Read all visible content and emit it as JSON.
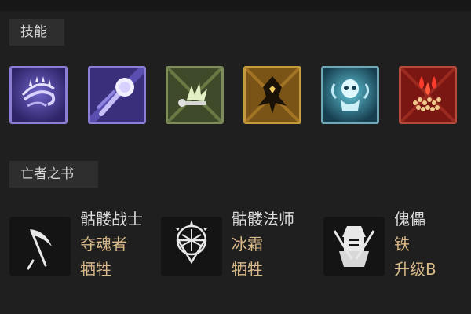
{
  "sections": {
    "skills_title": "技能",
    "book_title": "亡者之书"
  },
  "skills": [
    {
      "icon": "bone-spear-curve-icon",
      "border_color": "#8a7fd4",
      "bg_color": "#3a2f7a"
    },
    {
      "icon": "spirit-orb-icon",
      "border_color": "#8a7fd4",
      "bg_color": "#3a2f7a"
    },
    {
      "icon": "corpse-explosion-icon",
      "border_color": "#7d8c5a",
      "bg_color": "#3f4a2a"
    },
    {
      "icon": "golden-demon-icon",
      "border_color": "#c49a3c",
      "bg_color": "#6b4c13"
    },
    {
      "icon": "skeleton-spirit-icon",
      "border_color": "#6fa7b7",
      "bg_color": "#1f4b5e"
    },
    {
      "icon": "blood-drops-icon",
      "border_color": "#b64a3a",
      "bg_color": "#6e1410"
    }
  ],
  "book_of_dead": [
    {
      "icon": "scythe-icon",
      "name": "骷髅战士",
      "choice": "夺魂者",
      "upgrade": "牺牲"
    },
    {
      "icon": "frost-sigil-icon",
      "name": "骷髅法师",
      "choice": "冰霜",
      "upgrade": "牺牲"
    },
    {
      "icon": "golem-helm-icon",
      "name": "傀儡",
      "choice": "铁",
      "upgrade": "升级B"
    }
  ]
}
